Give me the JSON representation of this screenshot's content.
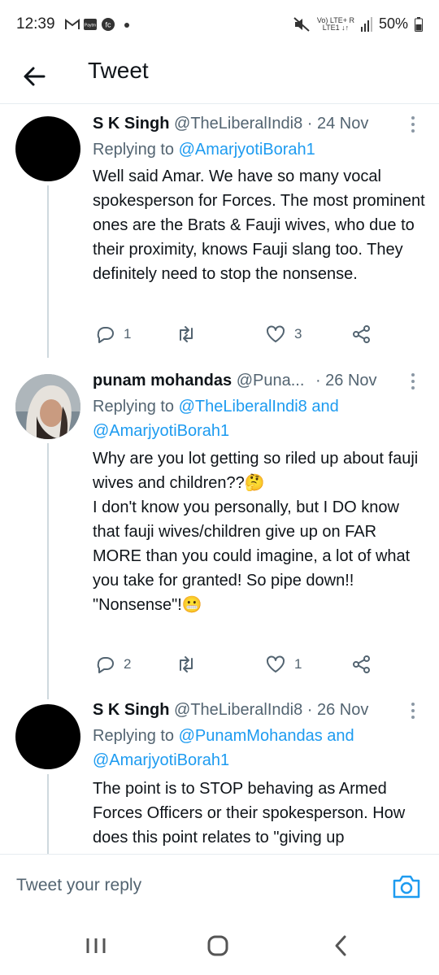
{
  "status_bar": {
    "time": "12:39",
    "notif_icons": [
      "gmail-icon",
      "paytm-icon",
      "fc-icon",
      "dot"
    ],
    "network_top": "Vo) LTE+ R",
    "network_bottom": "LTE1 ↓↑",
    "battery": "50%"
  },
  "header": {
    "title": "Tweet"
  },
  "tweets": [
    {
      "name": "S K Singh",
      "handle": "@TheLiberalIndi8",
      "date": "· 24 Nov",
      "replying_prefix": "Replying to ",
      "replying_to": [
        "@AmarjyotiBorah1"
      ],
      "replying_joiner": "",
      "text": "Well said Amar. We have so many vocal spokesperson for Forces. The most prominent ones are the Brats & Fauji wives, who due to their proximity, knows Fauji slang too. They definitely need to stop the nonsense.",
      "replies": "1",
      "retweets": "",
      "likes": "3"
    },
    {
      "name": "punam mohandas",
      "handle": "@Puna...",
      "date": "· 26 Nov",
      "replying_prefix": "Replying to ",
      "replying_to": [
        "@TheLiberalIndi8",
        "@AmarjyotiBorah1"
      ],
      "replying_joiner": " and",
      "text": "Why are you lot getting so riled up about fauji wives and children??🤔\nI don't know you personally, but I DO know that fauji wives/children give up on FAR MORE than you could imagine, a lot of what you take for granted! So pipe down!!\n\"Nonsense\"!😬",
      "replies": "2",
      "retweets": "",
      "likes": "1"
    },
    {
      "name": "S K Singh",
      "handle": "@TheLiberalIndi8",
      "date": "· 26 Nov",
      "replying_prefix": "Replying to ",
      "replying_to": [
        "@PunamMohandas",
        "@AmarjyotiBorah1"
      ],
      "replying_joiner": " and",
      "text": "The point is to STOP behaving as Armed Forces Officers or their spokesperson. How does this point relates to \"giving up"
    }
  ],
  "reply_bar": {
    "placeholder": "Tweet your reply"
  },
  "colors": {
    "link": "#1d9bf0",
    "muted": "#536471",
    "text": "#0f1419",
    "divider": "#e6ecf0"
  }
}
